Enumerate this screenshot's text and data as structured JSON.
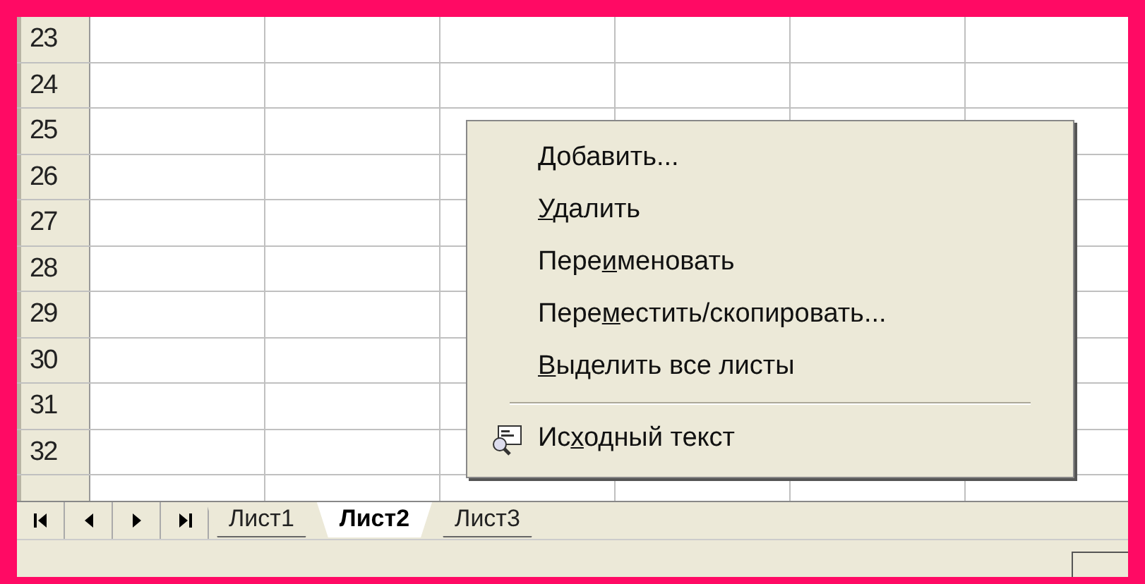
{
  "rows": [
    {
      "header": "23"
    },
    {
      "header": "24"
    },
    {
      "header": "25"
    },
    {
      "header": "26"
    },
    {
      "header": "27"
    },
    {
      "header": "28"
    },
    {
      "header": "29"
    },
    {
      "header": "30"
    },
    {
      "header": "31"
    },
    {
      "header": "32"
    }
  ],
  "nav_buttons": [
    {
      "kind": "first"
    },
    {
      "kind": "prev"
    },
    {
      "kind": "next"
    },
    {
      "kind": "last"
    }
  ],
  "sheet_tabs": [
    {
      "label": "Лист1",
      "selected": false
    },
    {
      "label": "Лист2",
      "selected": true
    },
    {
      "label": "Лист3",
      "selected": false
    }
  ],
  "context_menu": {
    "items": [
      {
        "kind": "item",
        "key": "Д",
        "after": "обавить..."
      },
      {
        "kind": "item",
        "key": "У",
        "after": "далить"
      },
      {
        "kind": "item",
        "before": "Пере",
        "key": "и",
        "after": "меновать"
      },
      {
        "kind": "item",
        "before": "Пере",
        "key": "м",
        "after": "естить/скопировать..."
      },
      {
        "kind": "item",
        "key": "В",
        "after": "ыделить все листы"
      },
      {
        "kind": "separator"
      },
      {
        "kind": "icon_item",
        "before": "Ис",
        "key": "х",
        "after": "одный текст"
      }
    ]
  }
}
